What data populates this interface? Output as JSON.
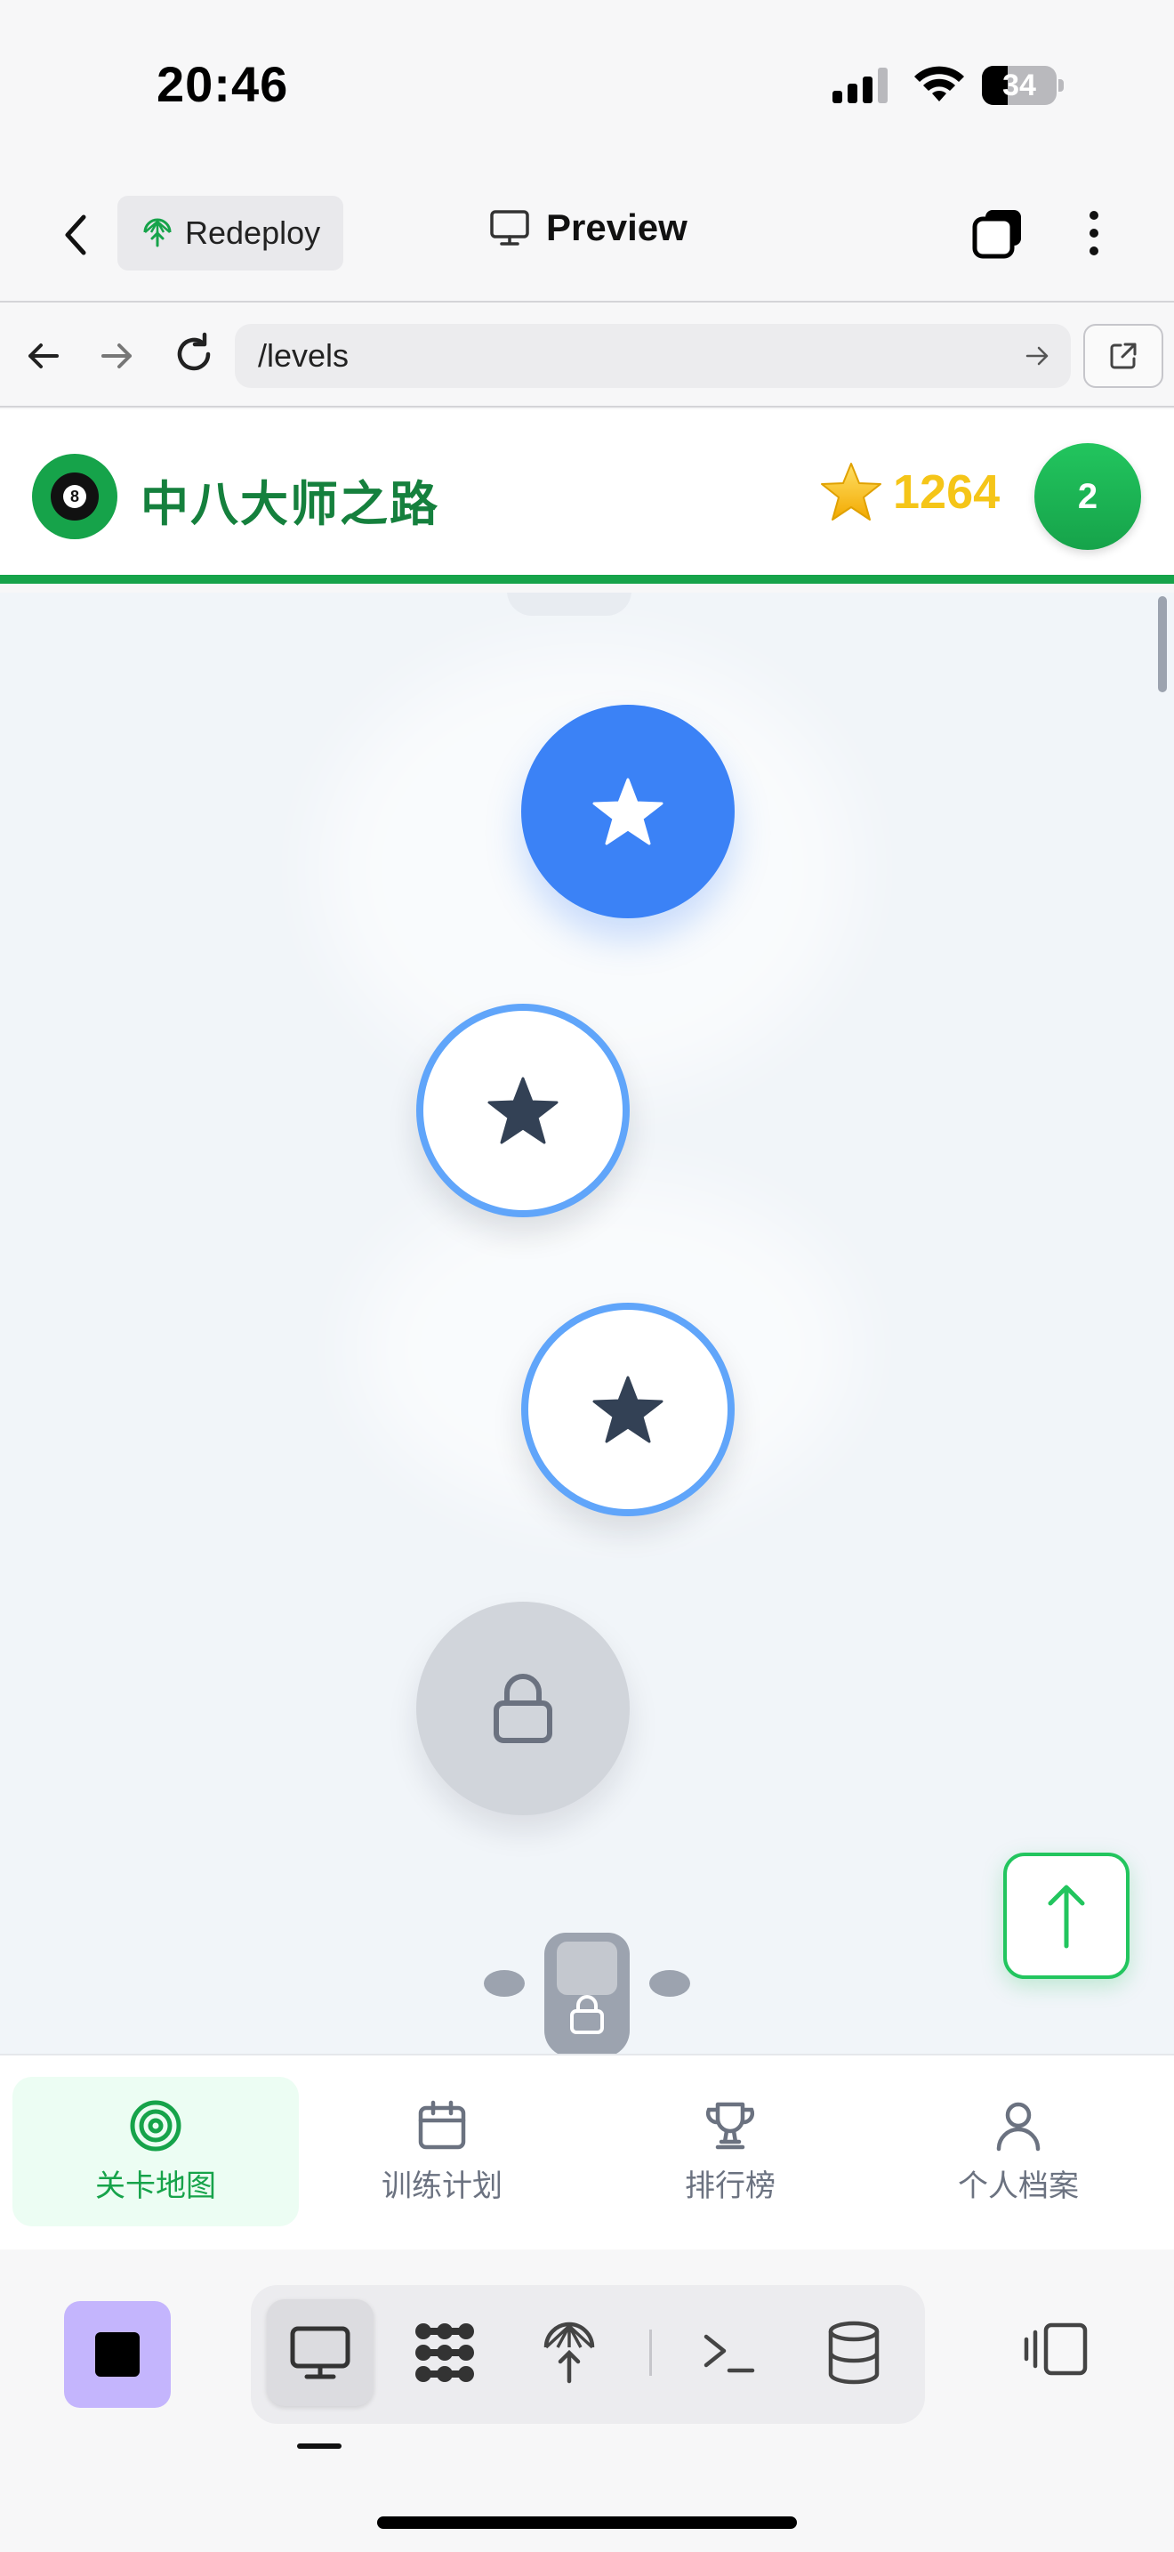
{
  "status_bar": {
    "time": "20:46",
    "battery": "34",
    "battery_level": 0.34
  },
  "header": {
    "redeploy_label": "Redeploy",
    "title": "Preview"
  },
  "browser": {
    "url": "/levels"
  },
  "app": {
    "title": "中八大师之路",
    "score": "1264",
    "level": "2",
    "brand_color": "#16a34a"
  },
  "map": {
    "nodes": [
      {
        "state": "active",
        "icon": "star-icon"
      },
      {
        "state": "completed",
        "icon": "star-icon"
      },
      {
        "state": "completed",
        "icon": "star-icon"
      },
      {
        "state": "locked",
        "icon": "lock-icon"
      }
    ],
    "chest": {
      "state": "locked",
      "icon": "lock-icon"
    }
  },
  "tabs": [
    {
      "label": "关卡地图",
      "icon": "target-icon",
      "active": true
    },
    {
      "label": "训练计划",
      "icon": "calendar-icon",
      "active": false
    },
    {
      "label": "排行榜",
      "icon": "trophy-icon",
      "active": false
    },
    {
      "label": "个人档案",
      "icon": "user-icon",
      "active": false
    }
  ],
  "colors": {
    "active_node": "#3b82f6",
    "completed_ring": "#60a5fa",
    "locked_node": "#d1d5db",
    "score_gold": "#f5c518"
  }
}
